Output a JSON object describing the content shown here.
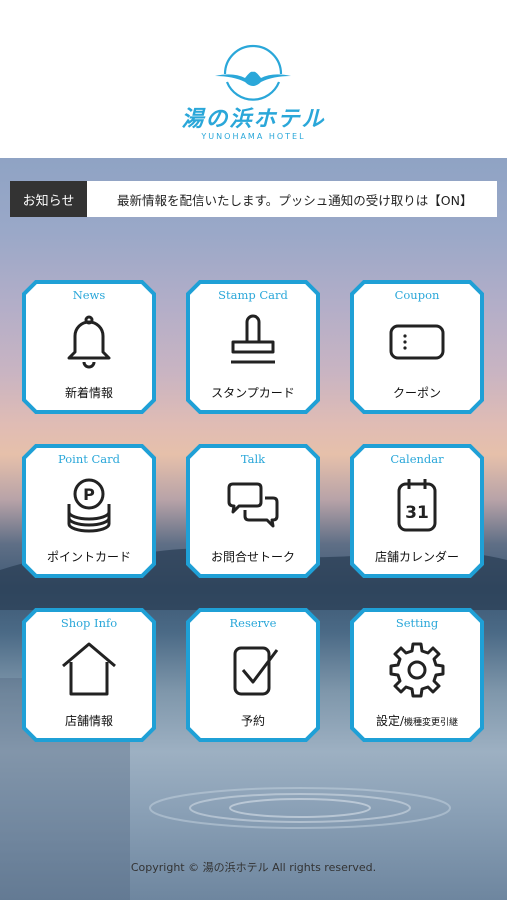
{
  "header": {
    "logo_jp": "湯の浜ホテル",
    "logo_en": "YUNOHAMA HOTEL"
  },
  "notice": {
    "label": "お知らせ",
    "text": "最新情報を配信いたします。プッシュ通知の受け取りは【ON】"
  },
  "menu": {
    "news": {
      "en": "News",
      "jp": "新着情報",
      "icon": "bell-icon"
    },
    "stamp": {
      "en": "Stamp Card",
      "jp": "スタンプカード",
      "icon": "stamp-icon"
    },
    "coupon": {
      "en": "Coupon",
      "jp": "クーポン",
      "icon": "coupon-ticket-icon"
    },
    "point": {
      "en": "Point Card",
      "jp": "ポイントカード",
      "icon": "coin-stack-icon"
    },
    "talk": {
      "en": "Talk",
      "jp": "お問合せトーク",
      "icon": "chat-bubbles-icon"
    },
    "calendar": {
      "en": "Calendar",
      "jp": "店舗カレンダー",
      "icon": "calendar-icon",
      "day": "31"
    },
    "shop": {
      "en": "Shop Info",
      "jp": "店舗情報",
      "icon": "house-icon"
    },
    "reserve": {
      "en": "Reserve",
      "jp": "予約",
      "icon": "checkbox-icon"
    },
    "setting": {
      "en": "Setting",
      "jp_main": "設定/",
      "jp_small": "機種変更引継",
      "icon": "gear-icon"
    }
  },
  "footer": {
    "copyright": "Copyright © 湯の浜ホテル All rights reserved."
  },
  "colors": {
    "accent": "#2aa7d9",
    "notice_label_bg": "#333333"
  }
}
